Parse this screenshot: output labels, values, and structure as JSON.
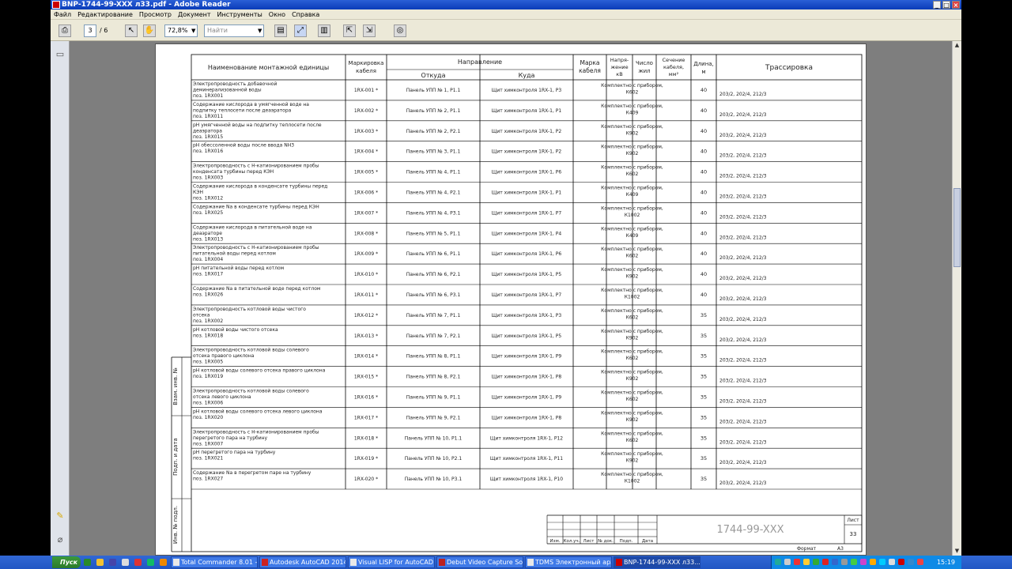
{
  "window": {
    "title": "BNP-1744-99-XXX л33.pdf - Adobe Reader",
    "controls": [
      "_",
      "□",
      "×"
    ]
  },
  "menu": [
    "Файл",
    "Редактирование",
    "Просмотр",
    "Документ",
    "Инструменты",
    "Окно",
    "Справка"
  ],
  "toolbar": {
    "page_current": "3",
    "page_total": "/ 6",
    "zoom": "72,8%",
    "find_placeholder": "Найти",
    "icons": [
      "print-icon",
      "select-icon",
      "hand-icon",
      "zoom-dropdown",
      "fit-page-icon",
      "fit-width-icon",
      "two-page-icon",
      "extract-icon",
      "extract2-icon",
      "attach-icon"
    ]
  },
  "sidepanel": {
    "icons": [
      "pages-icon",
      "comments-icon",
      "attachments-icon"
    ]
  },
  "doc": {
    "headers": {
      "name": "Наименование монтажной единицы",
      "marking": [
        "Маркировка",
        "кабеля"
      ],
      "direction": "Направление",
      "from": "Откуда",
      "to": "Куда",
      "cable_mark": [
        "Марка",
        "кабеля"
      ],
      "voltage": [
        "Напря-",
        "жение",
        "кВ"
      ],
      "cores": [
        "Число",
        "жил"
      ],
      "section": [
        "Сечение",
        "кабеля,",
        "мм²"
      ],
      "length": [
        "Длина,",
        "м"
      ],
      "route": "Трассировка"
    },
    "rows": [
      {
        "name": [
          "Электропроводность добавочной",
          "деминерализованной воды",
          "поз. 1RX001"
        ],
        "mark": "1RX-001",
        "from": "Панель УПП № 1, Р1.1",
        "to": "Щит химконтроля 1RX-1, Р3",
        "cable": [
          "Комплектно с прибором,",
          "К602"
        ],
        "len": "40",
        "route": "203/2, 202/4, 212/3"
      },
      {
        "name": [
          "Содержание кислорода в умягченной воде на",
          "подпитку теплосети после деаэратора",
          "поз. 1RX011"
        ],
        "mark": "1RX-002",
        "from": "Панель УПП № 2, Р1.1",
        "to": "Щит химконтроля 1RX-1, Р1",
        "cable": [
          "Комплектно с прибором,",
          "К409"
        ],
        "len": "40",
        "route": "203/2, 202/4, 212/3"
      },
      {
        "name": [
          "рН умягченной воды на подпитку теплосети после",
          "деаэратора",
          "поз. 1RX015"
        ],
        "mark": "1RX-003",
        "from": "Панель УПП № 2, Р2.1",
        "to": "Щит химконтроля 1RX-1, Р2",
        "cable": [
          "Комплектно с прибором,",
          "К902"
        ],
        "len": "40",
        "route": "203/2, 202/4, 212/3"
      },
      {
        "name": [
          "рН обессоленной воды после ввода NH3",
          "поз. 1RX016"
        ],
        "mark": "1RX-004",
        "from": "Панель УПП № 3, Р1.1",
        "to": "Щит химконтроля 1RX-1, Р2",
        "cable": [
          "Комплектно с прибором,",
          "К902"
        ],
        "len": "40",
        "route": "203/2, 202/4, 212/3"
      },
      {
        "name": [
          "Электропроводность с Н-катионированием пробы",
          "конденсата турбины перед КЭН",
          "поз. 1RX003"
        ],
        "mark": "1RX-005",
        "from": "Панель УПП № 4, Р1.1",
        "to": "Щит химконтроля 1RX-1, Р6",
        "cable": [
          "Комплектно с прибором,",
          "К602"
        ],
        "len": "40",
        "route": "203/2, 202/4, 212/3"
      },
      {
        "name": [
          "Содержание кислорода в конденсате турбины перед",
          "КЭН",
          "поз. 1RX012"
        ],
        "mark": "1RX-006",
        "from": "Панель УПП № 4, Р2.1",
        "to": "Щит химконтроля 1RX-1, Р1",
        "cable": [
          "Комплектно с прибором,",
          "К409"
        ],
        "len": "40",
        "route": "203/2, 202/4, 212/3"
      },
      {
        "name": [
          "Содержание Na в конденсате турбины перед КЭН",
          "поз. 1RX025"
        ],
        "mark": "1RX-007",
        "from": "Панель УПП № 4, Р3.1",
        "to": "Щит химконтроля 1RX-1, Р7",
        "cable": [
          "Комплектно с прибором,",
          "К1002"
        ],
        "len": "40",
        "route": "203/2, 202/4, 212/3"
      },
      {
        "name": [
          "Содержание кислорода в питательной воде на",
          "деаэраторе",
          "поз. 1RX013"
        ],
        "mark": "1RX-008",
        "from": "Панель УПП № 5, Р1.1",
        "to": "Щит химконтроля 1RX-1, Р4",
        "cable": [
          "Комплектно с прибором,",
          "К409"
        ],
        "len": "40",
        "route": "203/2, 202/4, 212/3"
      },
      {
        "name": [
          "Электропроводность с Н-катионированием пробы",
          "питательной воды перед котлом",
          "поз. 1RX004"
        ],
        "mark": "1RX-009",
        "from": "Панель УПП № 6, Р1.1",
        "to": "Щит химконтроля 1RX-1, Р6",
        "cable": [
          "Комплектно с прибором,",
          "К602"
        ],
        "len": "40",
        "route": "203/2, 202/4, 212/3"
      },
      {
        "name": [
          "рН питательной воды перед котлом",
          "поз. 1RX017"
        ],
        "mark": "1RX-010",
        "from": "Панель УПП № 6, Р2.1",
        "to": "Щит химконтроля 1RX-1, Р5",
        "cable": [
          "Комплектно с прибором,",
          "К902"
        ],
        "len": "40",
        "route": "203/2, 202/4, 212/3"
      },
      {
        "name": [
          "Содержание Na в питательной воде перед котлом",
          "поз. 1RX026"
        ],
        "mark": "1RX-011",
        "from": "Панель УПП № 6, Р3.1",
        "to": "Щит химконтроля 1RX-1, Р7",
        "cable": [
          "Комплектно с прибором,",
          "К1002"
        ],
        "len": "40",
        "route": "203/2, 202/4, 212/3"
      },
      {
        "name": [
          "Электропроводность котловой воды чистого",
          "отсека",
          "поз. 1RX002"
        ],
        "mark": "1RX-012",
        "from": "Панель УПП № 7, Р1.1",
        "to": "Щит химконтроля 1RX-1, Р3",
        "cable": [
          "Комплектно с прибором,",
          "К602"
        ],
        "len": "35",
        "route": "203/2, 202/4, 212/3"
      },
      {
        "name": [
          "рН котловой воды чистого отсека",
          "поз. 1RX018"
        ],
        "mark": "1RX-013",
        "from": "Панель УПП № 7, Р2.1",
        "to": "Щит химконтроля 1RX-1, Р5",
        "cable": [
          "Комплектно с прибором,",
          "К902"
        ],
        "len": "35",
        "route": "203/2, 202/4, 212/3"
      },
      {
        "name": [
          "Электропроводность котловой воды солевого",
          "отсека правого циклона",
          "поз. 1RX005"
        ],
        "mark": "1RX-014",
        "from": "Панель УПП № 8, Р1.1",
        "to": "Щит химконтроля 1RX-1, Р9",
        "cable": [
          "Комплектно с прибором,",
          "К602"
        ],
        "len": "35",
        "route": "203/2, 202/4, 212/3"
      },
      {
        "name": [
          "рН котловой воды солевого отсека правого циклона",
          "поз. 1RX019"
        ],
        "mark": "1RX-015",
        "from": "Панель УПП № 8, Р2.1",
        "to": "Щит химконтроля 1RX-1, Р8",
        "cable": [
          "Комплектно с прибором,",
          "К902"
        ],
        "len": "35",
        "route": "203/2, 202/4, 212/3"
      },
      {
        "name": [
          "Электропроводность котловой воды солевого",
          "отсека левого циклона",
          "поз. 1RX006"
        ],
        "mark": "1RX-016",
        "from": "Панель УПП № 9, Р1.1",
        "to": "Щит химконтроля 1RX-1, Р9",
        "cable": [
          "Комплектно с прибором,",
          "К602"
        ],
        "len": "35",
        "route": "203/2, 202/4, 212/3"
      },
      {
        "name": [
          "рН котловой воды солевого отсека левого циклона",
          "поз. 1RX020"
        ],
        "mark": "1RX-017",
        "from": "Панель УПП № 9, Р2.1",
        "to": "Щит химконтроля 1RX-1, Р8",
        "cable": [
          "Комплектно с прибором,",
          "К902"
        ],
        "len": "35",
        "route": "203/2, 202/4, 212/3"
      },
      {
        "name": [
          "Электропроводность с Н-катионированием пробы",
          "перегретого пара на турбину",
          "поз. 1RX007"
        ],
        "mark": "1RX-018",
        "from": "Панель УПП № 10, Р1.1",
        "to": "Щит химконтроля 1RX-1, Р12",
        "cable": [
          "Комплектно с прибором,",
          "К602"
        ],
        "len": "35",
        "route": "203/2, 202/4, 212/3"
      },
      {
        "name": [
          "рН перегретого пара на турбину",
          "поз. 1RX021"
        ],
        "mark": "1RX-019",
        "from": "Панель УПП № 10, Р2.1",
        "to": "Щит химконтроля 1RX-1, Р11",
        "cable": [
          "Комплектно с прибором,",
          "К902"
        ],
        "len": "35",
        "route": "203/2, 202/4, 212/3"
      },
      {
        "name": [
          "Содержание Na в перегретом паре на турбину",
          "поз. 1RX027"
        ],
        "mark": "1RX-020",
        "from": "Панель УПП № 10, Р3.1",
        "to": "Щит химконтроля 1RX-1, Р10",
        "cable": [
          "Комплектно с прибором,",
          "К1002"
        ],
        "len": "35",
        "route": "203/2, 202/4, 212/3"
      }
    ],
    "margin_labels": [
      "Взам. инв. №",
      "Подп. и дата",
      "Инв. № подл."
    ],
    "stamp": {
      "doc_code": "1744-99-XXX",
      "sheet_label": "Лист",
      "sheet_no": "33",
      "cols": [
        "Изм.",
        "Кол.уч.",
        "Лист",
        "№ док.",
        "Подп.",
        "Дата"
      ],
      "format_label": "Формат",
      "format": "А3"
    }
  },
  "taskbar": {
    "start": "Пуск",
    "tasks": [
      "Total Commander 8.01 - ...",
      "Autodesk AutoCAD 2014...",
      "Visual LISP for AutoCAD ...",
      "Debut Video Capture Sof...",
      "TDMS Электронный арх...",
      "BNP-1744-99-XXX л33..."
    ],
    "clock": "15:19"
  }
}
